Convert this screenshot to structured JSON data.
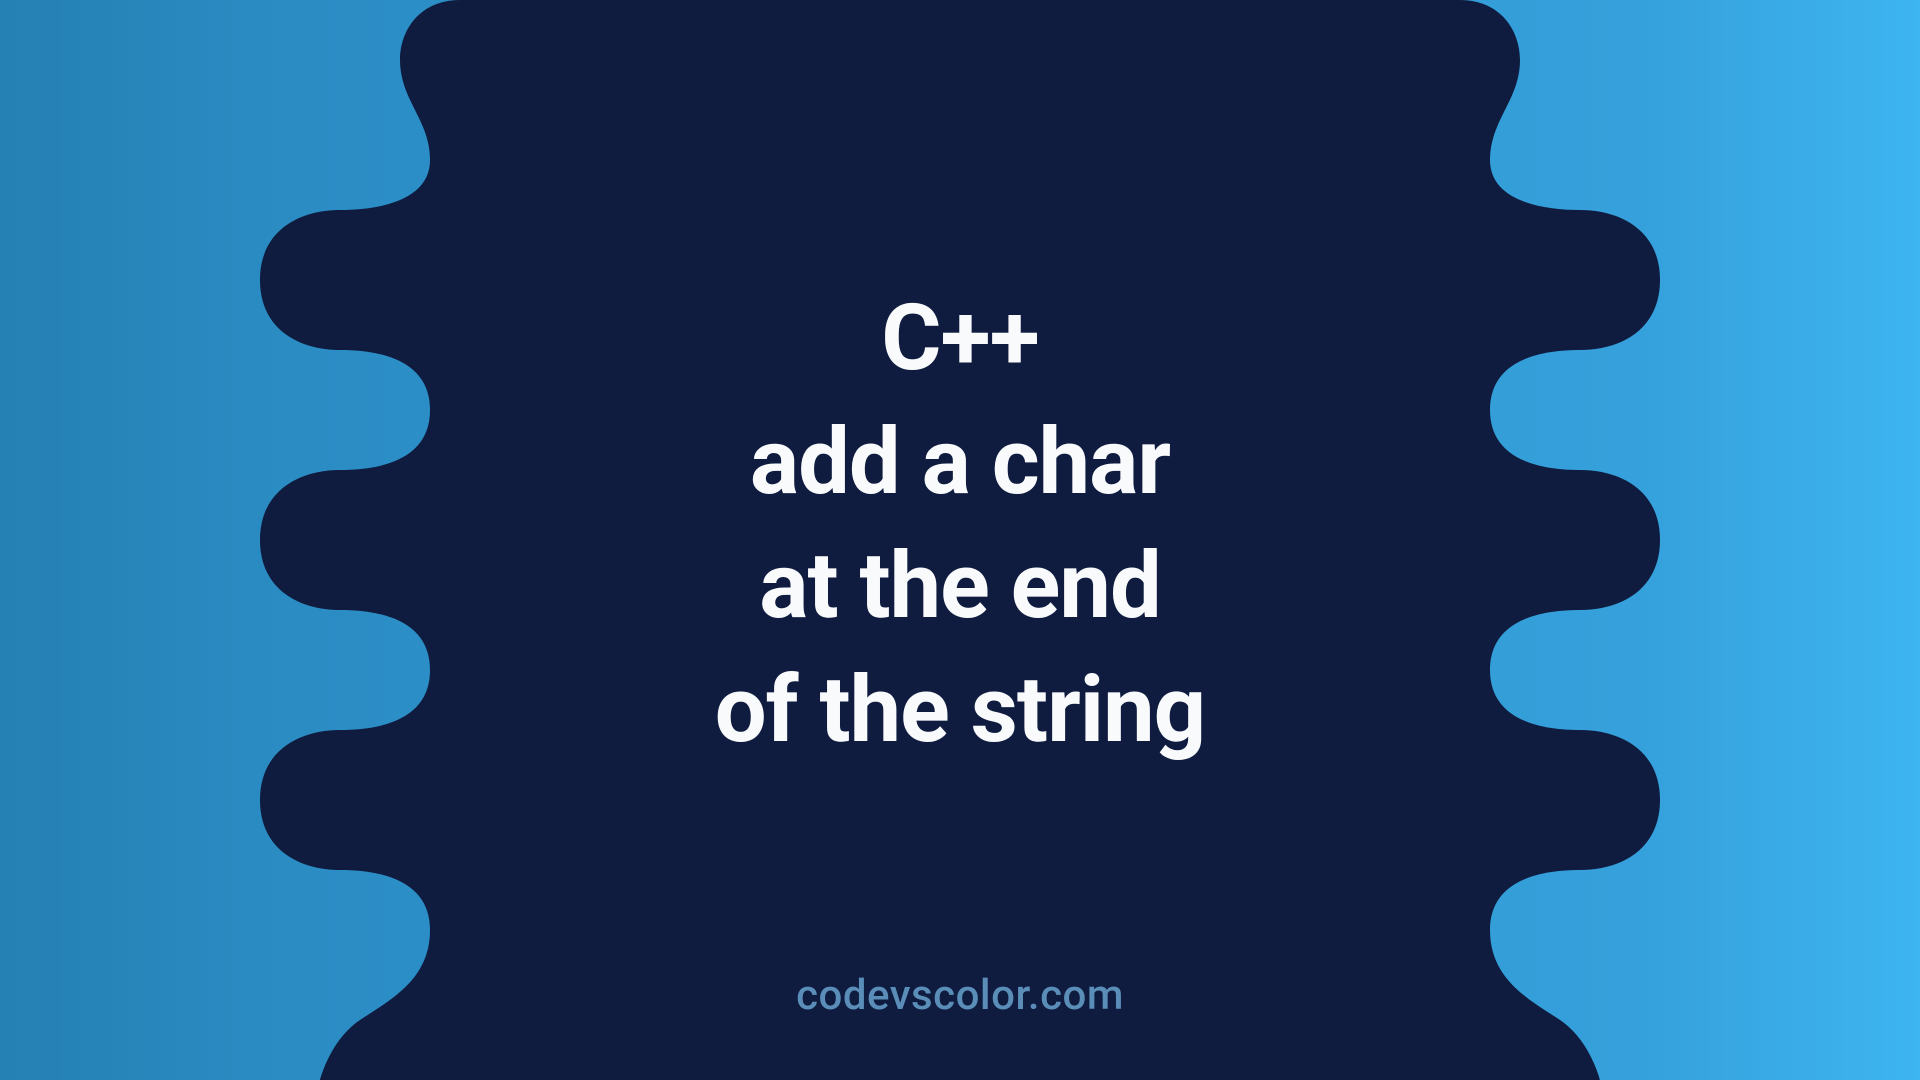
{
  "title": {
    "line1": "C++",
    "line2": "add a char",
    "line3": "at the end",
    "line4": "of the string"
  },
  "footer": "codevscolor.com",
  "colors": {
    "blob": "#0f1c3f",
    "gradient_left": "#2580b3",
    "gradient_right": "#3db5f0",
    "text": "#f8fafc",
    "footer": "#5a8db8"
  }
}
